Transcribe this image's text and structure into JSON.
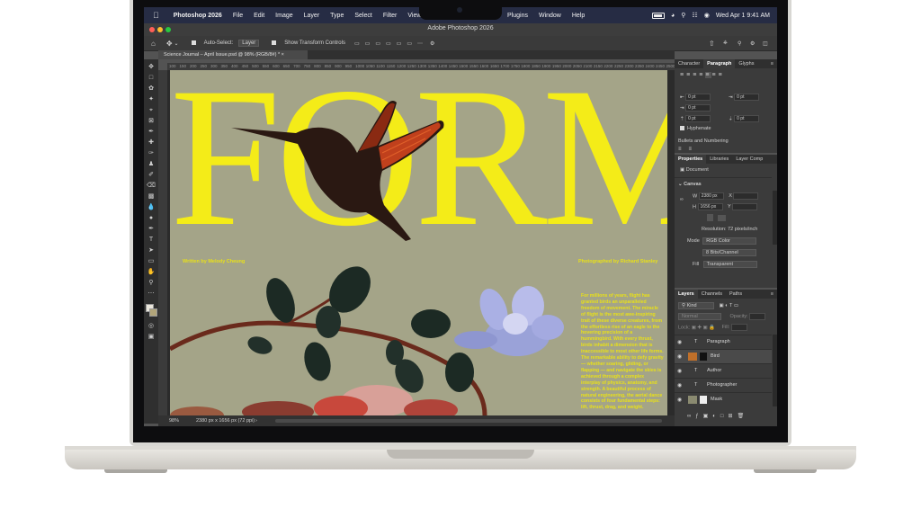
{
  "menubar": {
    "app_name": "Photoshop 2026",
    "menus": [
      "File",
      "Edit",
      "Image",
      "Layer",
      "Type",
      "Select",
      "Filter",
      "View"
    ],
    "menus_right": [
      "Plugins",
      "Window",
      "Help"
    ],
    "clock": "Wed Apr 1  9:41 AM"
  },
  "window": {
    "title": "Adobe Photoshop 2026"
  },
  "options": {
    "auto_select_label": "Auto-Select:",
    "auto_select_value": "Layer",
    "transform_label": "Show Transform Controls"
  },
  "document": {
    "tab_title": "Science Journal – April Issue.psd @ 98% (RGB/8#) *",
    "ruler_marks": [
      "100",
      "150",
      "200",
      "250",
      "300",
      "350",
      "400",
      "450",
      "500",
      "550",
      "600",
      "650",
      "700",
      "750",
      "800",
      "850",
      "900",
      "950",
      "1000",
      "1050",
      "1100",
      "1150",
      "1200",
      "1250",
      "1300",
      "1350",
      "1400",
      "1450",
      "1500",
      "1550",
      "1600",
      "1650",
      "1700",
      "1750",
      "1800",
      "1850",
      "1900",
      "1950",
      "2000",
      "2050",
      "2100",
      "2150",
      "2200",
      "2250",
      "2300",
      "2350",
      "2400",
      "2450",
      "2500"
    ],
    "headline": "FORM",
    "credit_left": "Written by Melody Cheung",
    "credit_right": "Photographed by Richard Stanley",
    "body_text": "For millions of years, flight has granted birds an unparalleled freedom of movement. The miracle of flight is the most awe-inspiring trait of these diverse creatures, from the effortless rise of an eagle to the hovering precision of a hummingbird. With every thrust, birds inhabit a dimension that is inaccessible to most other life forms. The remarkable ability to defy gravity — whether soaring, gliding, or flapping — and navigate the skies is achieved through a complex interplay of physics, anatomy, and strength. A beautiful process of natural engineering, the aerial dance consists of four fundamental steps: lift, thrust, drag, and weight."
  },
  "status": {
    "zoom": "98%",
    "doc_size": "2380 px x 1656 px (72 ppi)"
  },
  "paragraph_panel": {
    "tabs": [
      "Character",
      "Paragraph",
      "Glyphs"
    ],
    "fields": [
      "0 pt",
      "0 pt",
      "0 pt",
      "0 pt",
      "0 pt"
    ],
    "hyphenate": "Hyphenate",
    "bullets": "Bullets and Numbering"
  },
  "properties_panel": {
    "tabs": [
      "Properties",
      "Libraries",
      "Layer Comp"
    ],
    "doc_label": "Document",
    "canvas_label": "Canvas",
    "w_label": "W",
    "w_value": "2380 px",
    "x_label": "X",
    "h_label": "H",
    "h_value": "1656 px",
    "y_label": "Y",
    "resolution": "Resolution: 72 pixels/inch",
    "mode_label": "Mode",
    "mode_value": "RGB Color",
    "depth_value": "8 Bits/Channel",
    "fill_label": "Fill",
    "fill_value": "Transparent"
  },
  "layers_panel": {
    "tabs": [
      "Layers",
      "Channels",
      "Paths"
    ],
    "kind": "Kind",
    "blend": "Normal",
    "opacity_label": "Opacity:",
    "fill_label": "Fill:",
    "lock_label": "Lock:",
    "layers": [
      {
        "name": "Paragraph",
        "type": "text"
      },
      {
        "name": "Bird",
        "type": "image"
      },
      {
        "name": "Author",
        "type": "text"
      },
      {
        "name": "Photographer",
        "type": "text"
      },
      {
        "name": "Mask",
        "type": "image"
      }
    ]
  },
  "colors": {
    "menubar": "#262c44",
    "canvas_bg": "#a4a488",
    "headline_yellow": "#f4ec18",
    "panel": "#3b3b3b"
  }
}
